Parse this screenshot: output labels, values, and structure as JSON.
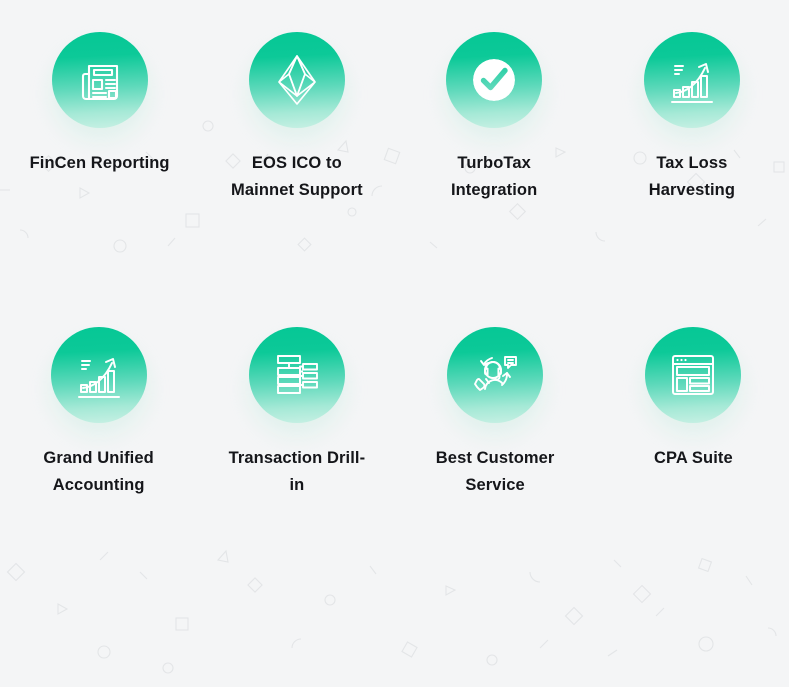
{
  "page": {
    "background_color": "#f4f5f6",
    "text_color": "#15161a",
    "accent_gradient_top": "#05c795",
    "accent_gradient_bottom": "#c8f0e4",
    "icon_stroke_color": "#ffffff"
  },
  "features": [
    {
      "label": "FinCen Reporting",
      "icon": "newspaper-report-icon",
      "row": 1,
      "column": 1
    },
    {
      "label": "EOS ICO to Mainnet Support",
      "icon": "eos-gem-icon",
      "row": 1,
      "column": 2
    },
    {
      "label": "TurboTax Integration",
      "icon": "check-circle-icon",
      "row": 1,
      "column": 3
    },
    {
      "label": "Tax Loss Harvesting",
      "icon": "growth-bar-chart-icon",
      "row": 1,
      "column": 4
    },
    {
      "label": "Grand Unified Accounting",
      "icon": "growth-bar-chart-icon",
      "row": 2,
      "column": 1
    },
    {
      "label": "Transaction Drill-in",
      "icon": "hierarchy-tree-icon",
      "row": 2,
      "column": 2
    },
    {
      "label": "Best Customer Service",
      "icon": "customer-support-agent-icon",
      "row": 2,
      "column": 3
    },
    {
      "label": "CPA Suite",
      "icon": "dashboard-window-icon",
      "row": 2,
      "column": 4
    }
  ]
}
